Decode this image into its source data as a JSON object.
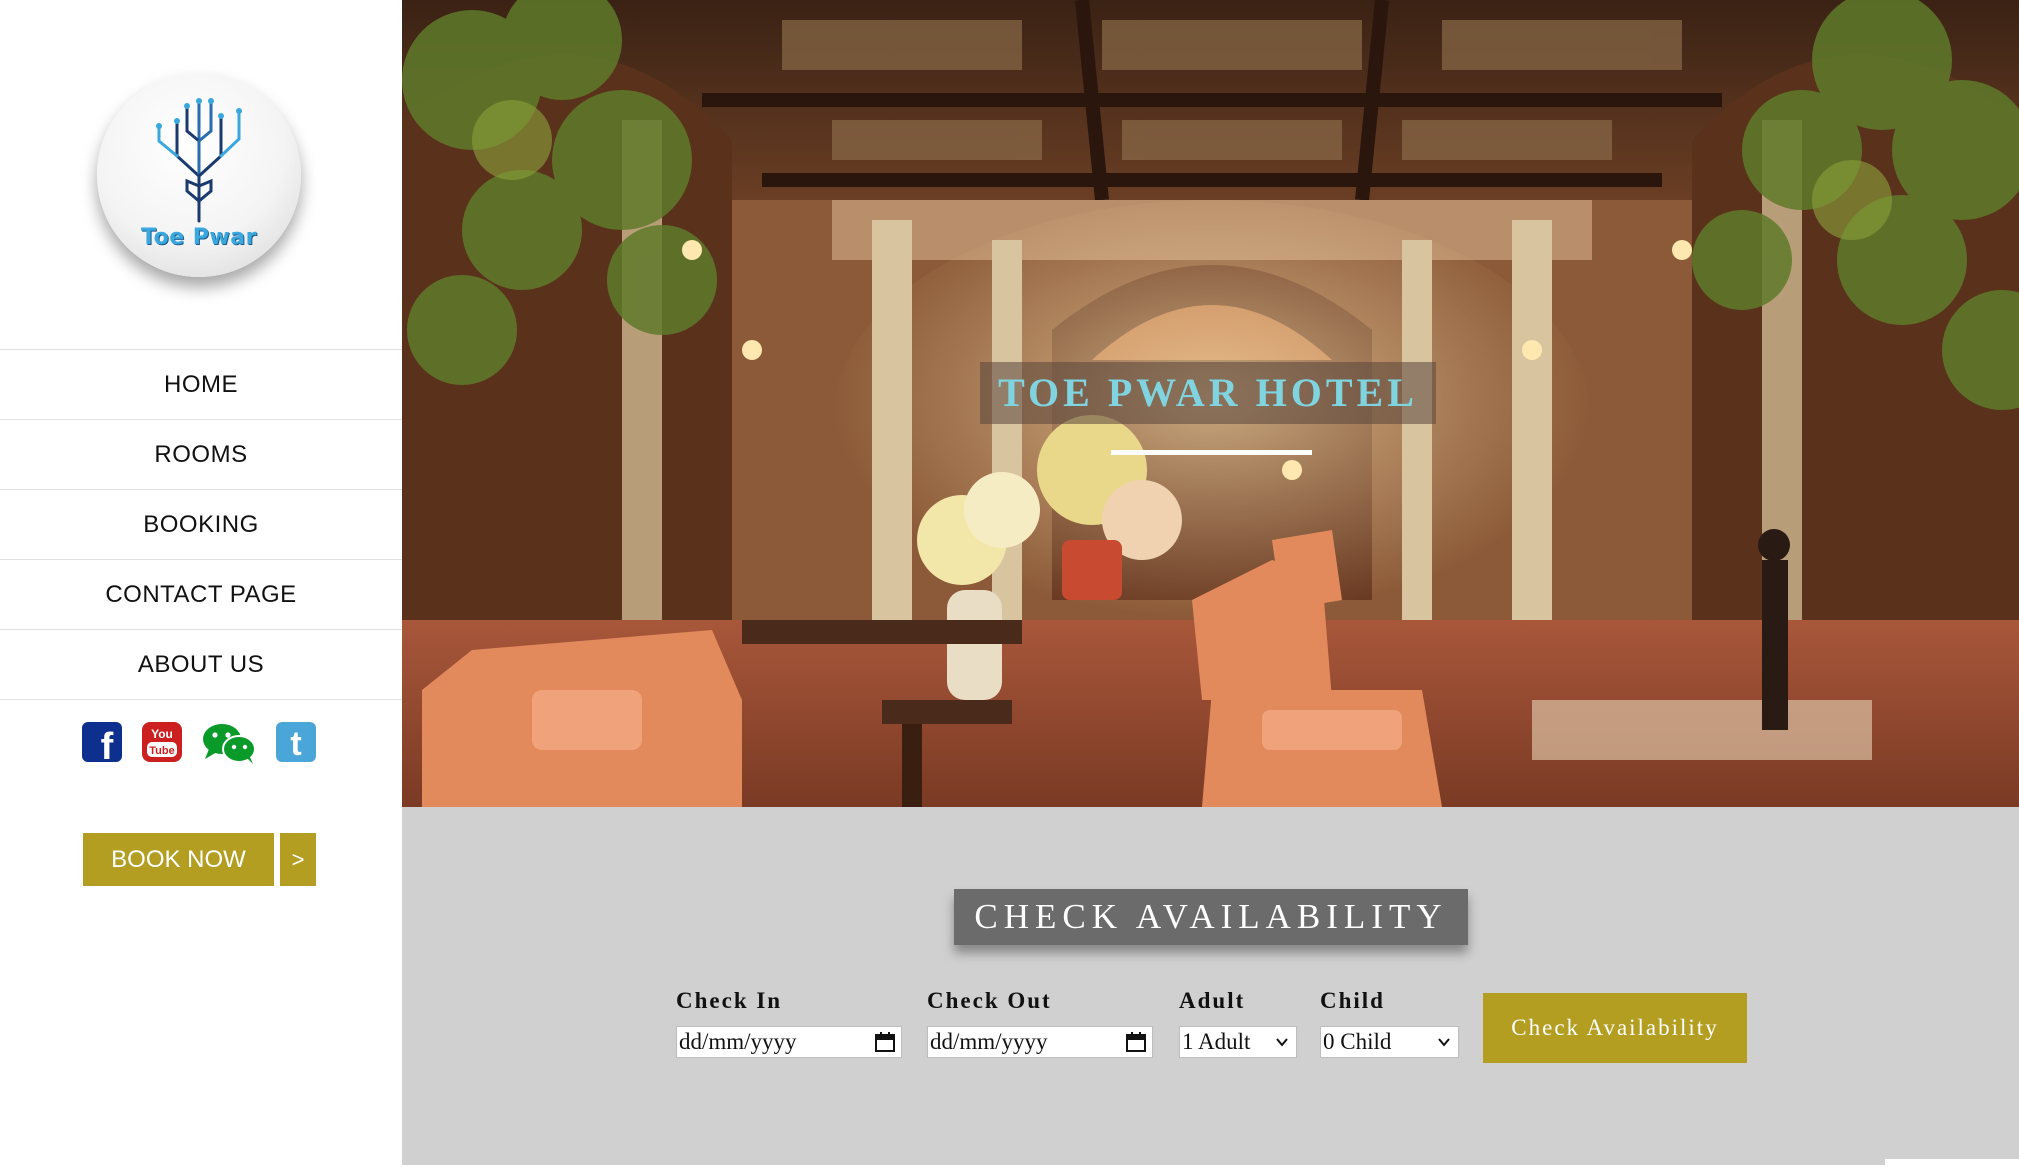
{
  "logo": {
    "text": "Toe Pwar"
  },
  "nav": {
    "items": [
      {
        "label": "HOME"
      },
      {
        "label": "ROOMS"
      },
      {
        "label": "BOOKING"
      },
      {
        "label": "CONTACT PAGE"
      },
      {
        "label": "ABOUT US"
      }
    ]
  },
  "socials": [
    {
      "name": "facebook-icon",
      "glyph": "f",
      "color": "#0d2f8e"
    },
    {
      "name": "youtube-icon",
      "top": "You",
      "bottom": "Tube",
      "color": "#cc1f1f"
    },
    {
      "name": "wechat-icon",
      "color": "#0a9a2a"
    },
    {
      "name": "tumblr-icon",
      "glyph": "t",
      "color": "#4aa6d8"
    }
  ],
  "book": {
    "label": "BOOK NOW",
    "arrow": ">"
  },
  "hero": {
    "title": "TOE PWAR HOTEL"
  },
  "availability": {
    "title": "CHECK AVAILABILITY",
    "check_in": {
      "label": "Check In",
      "value": "dd/mm/yyyy"
    },
    "check_out": {
      "label": "Check Out",
      "value": "dd/mm/yyyy"
    },
    "adult": {
      "label": "Adult",
      "value": "1 Adult"
    },
    "child": {
      "label": "Child",
      "value": "0 Child"
    },
    "button": "Check Availability"
  },
  "colors": {
    "accent": "#b39e22",
    "hero_title": "#7fd4e0",
    "panel": "#d0d0d0"
  }
}
